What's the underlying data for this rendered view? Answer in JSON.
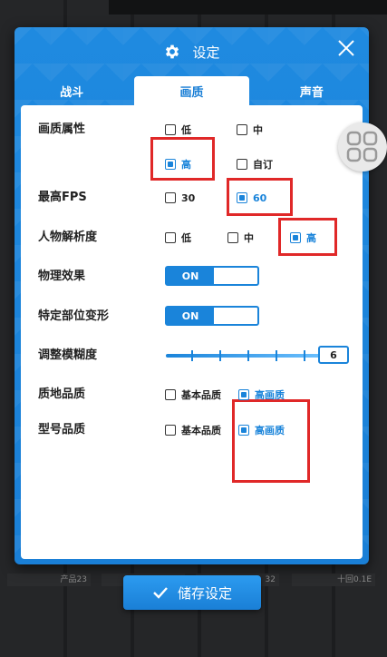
{
  "dialog": {
    "title": "设定",
    "tabs": [
      "战斗",
      "画质",
      "声音"
    ],
    "active_tab": 1
  },
  "settings": {
    "quality": {
      "label": "画质属性",
      "options": [
        "低",
        "中",
        "高",
        "自订"
      ],
      "selected": "高"
    },
    "fps": {
      "label": "最高FPS",
      "options": [
        "30",
        "60"
      ],
      "selected": "60"
    },
    "resolution": {
      "label": "人物解析度",
      "options": [
        "低",
        "中",
        "高"
      ],
      "selected": "高"
    },
    "physics": {
      "label": "物理效果",
      "state": "ON"
    },
    "deform": {
      "label": "特定部位变形",
      "state": "ON"
    },
    "blur": {
      "label": "调整模糊度",
      "value": "6",
      "level_fraction": 1.0
    },
    "texture": {
      "label": "质地品质",
      "options": [
        "基本品质",
        "高画质"
      ],
      "selected": "高画质"
    },
    "model": {
      "label": "型号品质",
      "options": [
        "基本品质",
        "高画质"
      ],
      "selected": "高画质"
    }
  },
  "save_button": {
    "label": "储存设定"
  },
  "background": {
    "cards": [
      "产品23",
      "",
      "32",
      "十回0.1E"
    ]
  },
  "colors": {
    "accent": "#1a84da",
    "highlight": "#e02828"
  }
}
